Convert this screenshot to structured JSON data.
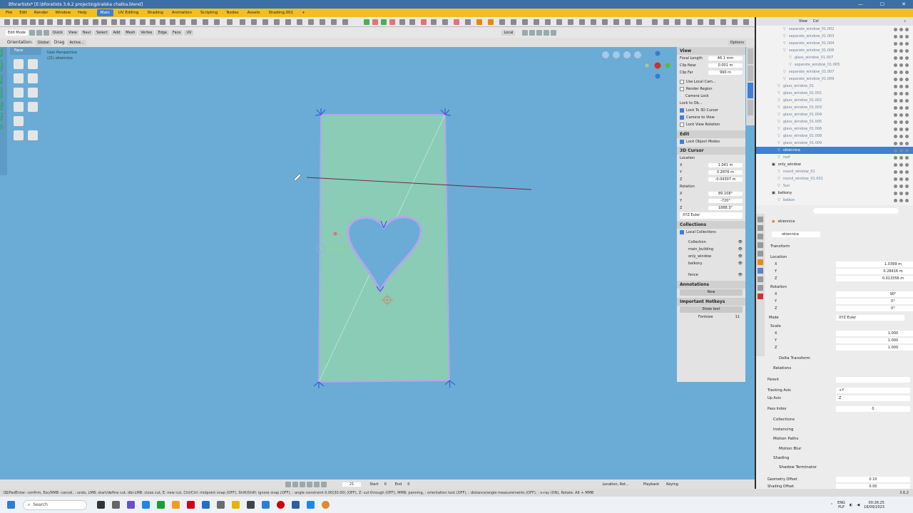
{
  "window": {
    "title": "Bforartists* [E:\\bforatists 3.6.2 projects\\góralska chatka.blend]",
    "controls": [
      "—",
      "☐",
      "✕"
    ]
  },
  "menubar": {
    "items": [
      "File",
      "Edit",
      "Render",
      "Window",
      "Help"
    ],
    "tabs": [
      "Main",
      "UV Editing",
      "Shading",
      "Animation",
      "Scripting",
      "Nodes",
      "Assets",
      "Shading.001"
    ],
    "add_tab": "+"
  },
  "toolbar": {
    "mode": "Edit Mode",
    "buttons": [
      "Quick",
      "View",
      "Navi",
      "Select",
      "Add",
      "Mesh",
      "Vertex",
      "Edge",
      "Face",
      "UV"
    ],
    "orientation_label": "Orientation:",
    "orientation_value": "Global",
    "drag_label": "Drag",
    "drag_value": "Active...",
    "transform_space": "Local",
    "options": "Options"
  },
  "viewport": {
    "tool_label": "Face",
    "perspective": "User Perspective",
    "object_info": "(21) okiennica",
    "left_tabs": [
      "Tools",
      "Object",
      "Mesh",
      "Vertex",
      "Edge",
      "Face",
      "UV"
    ]
  },
  "npanel": {
    "view": {
      "header": "View",
      "focal_length_label": "Focal Length",
      "focal_length": "46.1 mm",
      "clip_near_label": "Clip Near",
      "clip_near": "0.001 m",
      "clip_far_label": "Clip Far",
      "clip_far": "990 m",
      "use_local_cam": "Use Local Cam...",
      "render_region": "Render Region",
      "camera_lock": "Camera Lock",
      "lock_to_obj": "Lock to Ob...",
      "lock_3d_cursor": "Lock To 3D Cursor",
      "camera_to_view": "Camera to View",
      "lock_view_rotation": "Lock View Rotation"
    },
    "edit": {
      "header": "Edit",
      "lock_object_modes": "Lock Object Modes"
    },
    "cursor": {
      "header": "3D Cursor",
      "location_label": "Location",
      "loc": [
        {
          "axis": "X",
          "value": "1.041 m"
        },
        {
          "axis": "Y",
          "value": "0.2876 m"
        },
        {
          "axis": "Z",
          "value": "-0.04307 m"
        }
      ],
      "rotation_label": "Rotation",
      "rot": [
        {
          "axis": "X",
          "value": "89.108°"
        },
        {
          "axis": "Y",
          "value": "-720°"
        },
        {
          "axis": "Z",
          "value": "1888.3°"
        }
      ],
      "mode": "XYZ Euler"
    },
    "collections": {
      "header": "Collections",
      "local": "Local Collections",
      "items": [
        "Collection",
        "main_building",
        "only_window",
        "balkony",
        "fence"
      ]
    },
    "annotations": {
      "header": "Annotations",
      "new": "New"
    },
    "hotkeys": {
      "header": "Important Hotkeys",
      "show_text": "Show text",
      "fontsize_label": "Fontsize",
      "fontsize": "11"
    }
  },
  "outliner": {
    "header_items": [
      "View",
      "Col"
    ],
    "rows": [
      {
        "label": "separate_window_01.002",
        "indent": 4,
        "selected": false,
        "dark": false
      },
      {
        "label": "separate_window_01.003",
        "indent": 4,
        "selected": false,
        "dark": false
      },
      {
        "label": "separate_window_01.004",
        "indent": 4,
        "selected": false,
        "dark": false
      },
      {
        "label": "separate_window_01.006",
        "indent": 4,
        "selected": false,
        "dark": false
      },
      {
        "label": "glass_window_01.007",
        "indent": 5,
        "selected": false,
        "dark": false
      },
      {
        "label": "separate_window_01.005",
        "indent": 5,
        "selected": false,
        "dark": false
      },
      {
        "label": "separate_window_01.007",
        "indent": 4,
        "selected": false,
        "dark": false
      },
      {
        "label": "separate_window_01.009",
        "indent": 4,
        "selected": false,
        "dark": false
      },
      {
        "label": "glass_window_01",
        "indent": 3,
        "selected": false,
        "dark": false
      },
      {
        "label": "glass_window_01.001",
        "indent": 3,
        "selected": false,
        "dark": false
      },
      {
        "label": "glass_window_01.002",
        "indent": 3,
        "selected": false,
        "dark": false
      },
      {
        "label": "glass_window_01.003",
        "indent": 3,
        "selected": false,
        "dark": false
      },
      {
        "label": "glass_window_01.004",
        "indent": 3,
        "selected": false,
        "dark": false
      },
      {
        "label": "glass_window_01.005",
        "indent": 3,
        "selected": false,
        "dark": false
      },
      {
        "label": "glass_window_01.006",
        "indent": 3,
        "selected": false,
        "dark": false
      },
      {
        "label": "glass_window_01.008",
        "indent": 3,
        "selected": false,
        "dark": false
      },
      {
        "label": "glass_window_01.009",
        "indent": 3,
        "selected": false,
        "dark": false
      },
      {
        "label": "okiennica",
        "indent": 3,
        "selected": true,
        "dark": false
      },
      {
        "label": "roof",
        "indent": 3,
        "selected": false,
        "dark": false
      },
      {
        "label": "only_window",
        "indent": 2,
        "selected": false,
        "dark": true
      },
      {
        "label": "round_window_01",
        "indent": 3,
        "selected": false,
        "dark": false
      },
      {
        "label": "round_window_01.001",
        "indent": 3,
        "selected": false,
        "dark": false
      },
      {
        "label": "Sun",
        "indent": 3,
        "selected": false,
        "dark": false
      },
      {
        "label": "balkony",
        "indent": 2,
        "selected": false,
        "dark": true
      },
      {
        "label": "balkon",
        "indent": 3,
        "selected": false,
        "dark": false
      }
    ]
  },
  "properties": {
    "object_name": "okiennica",
    "datablock": "okiennica",
    "transform": "Transform",
    "location_label": "Location",
    "location": [
      {
        "axis": "X",
        "value": "1.0399 m"
      },
      {
        "axis": "Y",
        "value": "0.28416 m"
      },
      {
        "axis": "Z",
        "value": "0.013356 m"
      }
    ],
    "rotation_label": "Rotation",
    "rotation": [
      {
        "axis": "X",
        "value": "90°"
      },
      {
        "axis": "Y",
        "value": "0°"
      },
      {
        "axis": "Z",
        "value": "0°"
      }
    ],
    "mode_label": "Mode",
    "mode": "XYZ Euler",
    "scale_label": "Scale",
    "scale": [
      {
        "axis": "X",
        "value": "1.000"
      },
      {
        "axis": "Y",
        "value": "1.000"
      },
      {
        "axis": "Z",
        "value": "1.000"
      }
    ],
    "delta_transform": "Delta Transform",
    "relations": "Relations",
    "parent_label": "Parent",
    "tracking_axis_label": "Tracking Axis",
    "tracking_axis": "+Y",
    "up_axis_label": "Up Axis",
    "up_axis": "Z",
    "pass_index_label": "Pass Index",
    "pass_index": "0",
    "sections": [
      "Collections",
      "Instancing",
      "Motion Paths",
      "Motion Blur",
      "Shading"
    ],
    "shadow_terminator": "Shadow Terminator",
    "geometry_offset_label": "Geometry Offset",
    "geometry_offset": "0.10",
    "shading_offset_label": "Shading Offset",
    "shading_offset": "0.00"
  },
  "timeline": {
    "frame": "21",
    "start_label": "Start",
    "start": "0",
    "end_label": "End",
    "end": "0",
    "keying_set": "Location, Rot...",
    "playback": "Playback",
    "keying": "Keying"
  },
  "status": {
    "text": "⌫/PadEnter: confirm, Esc/RMB: cancel, : undo, LMB: start/define cut, dbl-LMB: close cut, E: new cut, Ctrl/Ctrl: midpoint snap (OFF), Shift/Shift: ignore snap (OFF), : angle constraint 0.00(30.00) (OFF), Z: cut through (OFF), MMB: panning, : orientation lock (OFF), : distance/angle measurements (OFF), : x-ray (ON), Rotate: Alt + MMB",
    "version": "3.6.2"
  },
  "taskbar": {
    "search_placeholder": "Search",
    "lang": "ENG",
    "lang2": "PLP",
    "time": "00:26:25",
    "date": "16/09/2023"
  }
}
